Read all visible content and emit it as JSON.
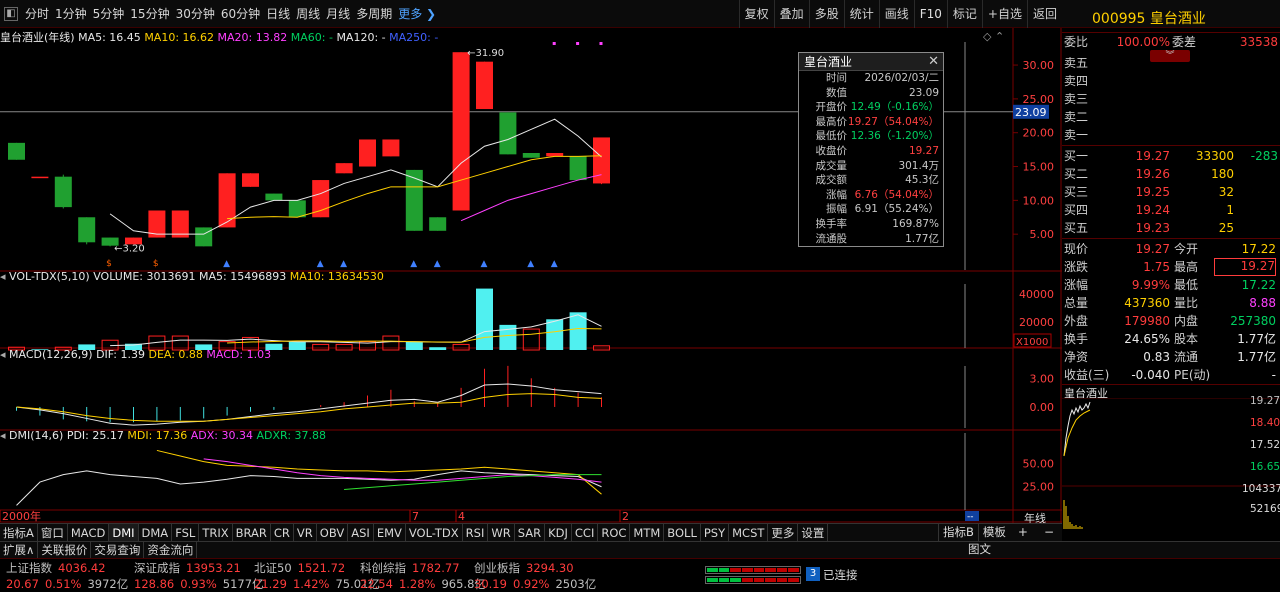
{
  "toolbar": {
    "periods": [
      "分时",
      "1分钟",
      "5分钟",
      "15分钟",
      "30分钟",
      "60分钟",
      "日线",
      "周线",
      "月线",
      "多周期"
    ],
    "more": "更多",
    "tools": [
      "复权",
      "叠加",
      "多股",
      "统计",
      "画线",
      "F10",
      "标记",
      "+自选",
      "返回"
    ]
  },
  "chart_info": {
    "name": "皇台酒业(年线)",
    "ma5": "MA5: 16.45",
    "ma10": "MA10: 16.62",
    "ma20": "MA20: 13.82",
    "ma60": "MA60: -",
    "ma120": "MA120: -",
    "ma250": "MA250: -"
  },
  "price_axis": [
    "30.00",
    "25.00",
    "20.00",
    "15.00",
    "10.00",
    "5.00"
  ],
  "crosshair_price": "23.09",
  "annotations": {
    "high": "31.90",
    "low": "3.20"
  },
  "vol_info": {
    "title": "VOL-TDX(5,10)",
    "volume": "VOLUME: 3013691",
    "ma5": "MA5: 15496893",
    "ma10": "MA10: 13634530"
  },
  "vol_axis": [
    "40000",
    "20000"
  ],
  "vol_unit": "X1000",
  "macd_info": {
    "title": "MACD(12,26,9)",
    "dif": "DIF: 1.39",
    "dea": "DEA: 0.88",
    "macd": "MACD: 1.03"
  },
  "macd_axis": [
    "3.00",
    "0.00"
  ],
  "dmi_info": {
    "title": "DMI(14,6)",
    "pdi": "PDI: 25.17",
    "mdi": "MDI: 17.36",
    "adx": "ADX: 30.34",
    "adxr": "ADXR: 37.88"
  },
  "dmi_axis": [
    "50.00",
    "25.00"
  ],
  "x_labels": [
    "2000年",
    "7",
    "4",
    "2"
  ],
  "tooltip": {
    "title": "皇台酒业",
    "rows": [
      {
        "label": "时间",
        "value": "2026/02/03/二"
      },
      {
        "label": "数值",
        "value": "23.09"
      },
      {
        "label": "开盘价",
        "value": "12.49（-0.16%）"
      },
      {
        "label": "最高价",
        "value": "19.27（54.04%）"
      },
      {
        "label": "最低价",
        "value": "12.36（-1.20%）"
      },
      {
        "label": "收盘价",
        "value": "19.27"
      },
      {
        "label": "成交量",
        "value": "301.4万"
      },
      {
        "label": "成交额",
        "value": "45.3亿"
      },
      {
        "label": "涨幅",
        "value": "6.76（54.04%）"
      },
      {
        "label": "振幅",
        "value": "6.91（55.24%）"
      },
      {
        "label": "换手率",
        "value": "169.87%"
      },
      {
        "label": "流通股",
        "value": "1.77亿"
      }
    ]
  },
  "quote": {
    "code": "000995",
    "name": "皇台酒业",
    "weibi_label": "委比",
    "weibi": "100.00%",
    "weicha_label": "委差",
    "weicha": "33538",
    "sells": [
      {
        "label": "卖五",
        "price": "",
        "vol": ""
      },
      {
        "label": "卖四",
        "price": "",
        "vol": ""
      },
      {
        "label": "卖三",
        "price": "",
        "vol": ""
      },
      {
        "label": "卖二",
        "price": "",
        "vol": ""
      },
      {
        "label": "卖一",
        "price": "",
        "vol": ""
      }
    ],
    "buys": [
      {
        "label": "买一",
        "price": "19.27",
        "vol": "33300",
        "chg": "-283"
      },
      {
        "label": "买二",
        "price": "19.26",
        "vol": "180",
        "chg": ""
      },
      {
        "label": "买三",
        "price": "19.25",
        "vol": "32",
        "chg": ""
      },
      {
        "label": "买四",
        "price": "19.24",
        "vol": "1",
        "chg": ""
      },
      {
        "label": "买五",
        "price": "19.23",
        "vol": "25",
        "chg": ""
      }
    ],
    "stats": [
      {
        "l1": "现价",
        "v1": "19.27",
        "l2": "今开",
        "v2": "17.22"
      },
      {
        "l1": "涨跌",
        "v1": "1.75",
        "l2": "最高",
        "v2": "19.27"
      },
      {
        "l1": "涨幅",
        "v1": "9.99%",
        "l2": "最低",
        "v2": "17.22"
      },
      {
        "l1": "总量",
        "v1": "437360",
        "l2": "量比",
        "v2": "8.88"
      },
      {
        "l1": "外盘",
        "v1": "179980",
        "l2": "内盘",
        "v2": "257380"
      },
      {
        "l1": "换手",
        "v1": "24.65%",
        "l2": "股本",
        "v2": "1.77亿"
      },
      {
        "l1": "净资",
        "v1": "0.83",
        "l2": "流通",
        "v2": "1.77亿"
      },
      {
        "l1": "收益(三)",
        "v1": "-0.040",
        "l2": "PE(动)",
        "v2": "-"
      }
    ],
    "mini_title": "皇台酒业",
    "mini_axis": [
      "19.27",
      "18.40",
      "17.52",
      "16.65",
      "104337",
      "52169"
    ],
    "year_label": "年线"
  },
  "bottom_tabs": [
    "指标A",
    "窗口",
    "MACD",
    "DMI",
    "DMA",
    "FSL",
    "TRIX",
    "BRAR",
    "CR",
    "VR",
    "OBV",
    "ASI",
    "EMV",
    "VOL-TDX",
    "RSI",
    "WR",
    "SAR",
    "KDJ",
    "CCI",
    "ROC",
    "MTM",
    "BOLL",
    "PSY",
    "MCST",
    "更多",
    "设置"
  ],
  "bottom_right": [
    "指标B",
    "模板",
    "+",
    "−"
  ],
  "bottom_tabs2": [
    "扩展∧",
    "关联报价",
    "交易查询",
    "资金流向"
  ],
  "bottom_right2": "图文",
  "indices": [
    {
      "name": "上证指数",
      "value": "4036.42",
      "chg": "20.67",
      "pct": "0.51%",
      "amt": "3972亿"
    },
    {
      "name": "深证成指",
      "value": "13953.21",
      "chg": "128.86",
      "pct": "0.93%",
      "amt": "5177亿"
    },
    {
      "name": "北证50",
      "value": "1521.72",
      "chg": "21.29",
      "pct": "1.42%",
      "amt": "75.01亿"
    },
    {
      "name": "科创综指",
      "value": "1782.77",
      "chg": "22.54",
      "pct": "1.28%",
      "amt": "965.8亿"
    },
    {
      "name": "创业板指",
      "value": "3294.30",
      "chg": "30.19",
      "pct": "0.92%",
      "amt": "2503亿"
    }
  ],
  "connection": {
    "count": "3",
    "text": "已连接"
  },
  "chart_data": {
    "type": "candlestick",
    "candles": [
      {
        "o": 18.5,
        "h": 18.5,
        "c": 16.0,
        "l": 16.0
      },
      {
        "o": 13.5,
        "h": 13.5,
        "c": 13.5,
        "l": 13.5
      },
      {
        "o": 13.5,
        "h": 13.8,
        "c": 9.0,
        "l": 8.8
      },
      {
        "o": 7.5,
        "h": 7.5,
        "c": 3.8,
        "l": 3.5
      },
      {
        "o": 4.5,
        "h": 4.5,
        "c": 3.3,
        "l": 3.2
      },
      {
        "o": 3.5,
        "h": 4.5,
        "c": 4.5,
        "l": 3.5
      },
      {
        "o": 4.5,
        "h": 8.5,
        "c": 8.5,
        "l": 4.5
      },
      {
        "o": 4.5,
        "h": 8.5,
        "c": 8.5,
        "l": 4.5
      },
      {
        "o": 6.0,
        "h": 6.0,
        "c": 3.2,
        "l": 3.2
      },
      {
        "o": 6.0,
        "h": 14.0,
        "c": 14.0,
        "l": 6.0
      },
      {
        "o": 12.0,
        "h": 14.0,
        "c": 14.0,
        "l": 12.0
      },
      {
        "o": 11.0,
        "h": 11.0,
        "c": 10.0,
        "l": 10.0
      },
      {
        "o": 10.0,
        "h": 10.0,
        "c": 7.5,
        "l": 7.5
      },
      {
        "o": 7.5,
        "h": 13.0,
        "c": 13.0,
        "l": 7.5
      },
      {
        "o": 14.0,
        "h": 15.5,
        "c": 15.5,
        "l": 14.0
      },
      {
        "o": 15.0,
        "h": 19.0,
        "c": 19.0,
        "l": 15.0
      },
      {
        "o": 16.5,
        "h": 19.0,
        "c": 19.0,
        "l": 16.5
      },
      {
        "o": 14.5,
        "h": 14.5,
        "c": 5.5,
        "l": 5.5
      },
      {
        "o": 7.5,
        "h": 7.5,
        "c": 5.5,
        "l": 5.5
      },
      {
        "o": 8.5,
        "h": 31.9,
        "c": 31.9,
        "l": 8.5
      },
      {
        "o": 23.5,
        "h": 30.5,
        "c": 30.5,
        "l": 23.5
      },
      {
        "o": 23.0,
        "h": 23.0,
        "c": 16.8,
        "l": 16.8
      },
      {
        "o": 17.0,
        "h": 17.0,
        "c": 16.3,
        "l": 16.3
      },
      {
        "o": 16.5,
        "h": 17.0,
        "c": 17.0,
        "l": 16.5
      },
      {
        "o": 16.5,
        "h": 16.5,
        "c": 13.0,
        "l": 13.0
      },
      {
        "o": 12.5,
        "h": 19.3,
        "c": 19.3,
        "l": 12.4
      }
    ],
    "ma5": [
      null,
      null,
      null,
      null,
      8.0,
      5.5,
      5.0,
      5.0,
      5.0,
      6.8,
      9.0,
      10.0,
      10.0,
      11.0,
      12.5,
      13.5,
      14.5,
      13.3,
      12.0,
      15.5,
      18.0,
      19.0,
      20.5,
      22.0,
      19.5,
      16.4
    ],
    "ma10": [
      null,
      null,
      null,
      null,
      null,
      null,
      null,
      null,
      null,
      7.3,
      7.5,
      7.6,
      7.5,
      8.5,
      9.8,
      11.0,
      12.0,
      12.0,
      12.0,
      13.0,
      14.0,
      15.0,
      16.0,
      16.5,
      16.5,
      16.6
    ],
    "ma20": [
      null,
      null,
      null,
      null,
      null,
      null,
      null,
      null,
      null,
      null,
      null,
      null,
      null,
      null,
      null,
      null,
      null,
      null,
      null,
      7.0,
      8.5,
      10.0,
      11.0,
      12.0,
      13.0,
      13.8
    ],
    "volume": [
      2000,
      500,
      2000,
      4000,
      7000,
      4500,
      10000,
      10000,
      4000,
      6000,
      9000,
      4500,
      6000,
      4000,
      4000,
      6000,
      10000,
      6000,
      2000,
      4000,
      44000,
      18000,
      15000,
      22000,
      27000,
      3000
    ],
    "vol_up": [
      false,
      true,
      false,
      false,
      true,
      true,
      true,
      true,
      false,
      true,
      true,
      false,
      false,
      true,
      true,
      true,
      true,
      false,
      false,
      true,
      true,
      true,
      false,
      true,
      true,
      true
    ],
    "vol_cyan": [
      false,
      true,
      false,
      true,
      false,
      true,
      false,
      false,
      true,
      false,
      false,
      true,
      true,
      false,
      false,
      false,
      false,
      true,
      true,
      false,
      true,
      true,
      false,
      true,
      true,
      false
    ],
    "macd_hist": [
      -0.4,
      -0.9,
      -1.3,
      -1.5,
      -1.6,
      -1.6,
      -1.5,
      -1.4,
      -1.2,
      -0.9,
      -0.5,
      -0.3,
      0.0,
      0.2,
      0.5,
      1.2,
      1.8,
      0.6,
      0.4,
      2.0,
      4.0,
      4.3,
      3.0,
      2.0,
      1.5,
      1.0
    ],
    "dif": [
      0,
      -0.3,
      -0.7,
      -1.2,
      -1.7,
      -1.9,
      -1.8,
      -1.6,
      -1.5,
      -1.3,
      -1.0,
      -0.7,
      -0.5,
      -0.2,
      0.1,
      0.4,
      0.7,
      0.8,
      0.5,
      1.2,
      2.3,
      2.4,
      2.2,
      1.8,
      1.6,
      1.4
    ],
    "dea": [
      0,
      -0.2,
      -0.5,
      -0.9,
      -1.2,
      -1.4,
      -1.5,
      -1.5,
      -1.5,
      -1.3,
      -1.1,
      -0.9,
      -0.7,
      -0.5,
      -0.2,
      0.0,
      0.2,
      0.4,
      0.4,
      0.5,
      1.0,
      1.3,
      1.4,
      1.3,
      1.0,
      0.9
    ],
    "pdi": [
      5,
      30,
      38,
      42,
      38,
      36,
      34,
      28,
      30,
      33,
      37,
      36,
      34,
      34,
      34,
      33,
      32,
      33,
      38,
      42,
      40,
      39,
      38,
      37,
      36,
      25
    ],
    "mdi": [
      null,
      null,
      null,
      null,
      null,
      null,
      64,
      58,
      52,
      48,
      47,
      46,
      44,
      43,
      42,
      42,
      41,
      42,
      43,
      44,
      46,
      44,
      42,
      40,
      38,
      17
    ],
    "adx": [
      null,
      null,
      null,
      null,
      null,
      null,
      null,
      null,
      55,
      52,
      48,
      44,
      40,
      37,
      35,
      34,
      33,
      32,
      32,
      34,
      36,
      38,
      37,
      35,
      33,
      30
    ],
    "adxr": [
      null,
      null,
      null,
      null,
      null,
      null,
      null,
      null,
      null,
      null,
      null,
      null,
      null,
      null,
      22,
      24,
      26,
      28,
      30,
      32,
      34,
      36,
      37,
      38,
      38,
      38
    ]
  }
}
